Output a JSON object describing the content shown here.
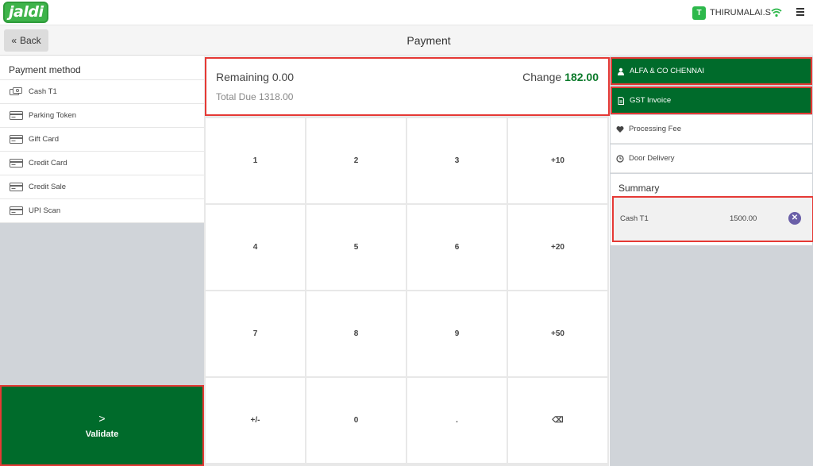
{
  "app": {
    "logo_text": "jaldi"
  },
  "topbar": {
    "user_initial": "T",
    "user_name": "THIRUMALAI.S"
  },
  "header": {
    "back_label": "Back",
    "title": "Payment"
  },
  "payment_methods": {
    "heading": "Payment method",
    "items": [
      {
        "label": "Cash T1",
        "icon": "cash-icon"
      },
      {
        "label": "Parking Token",
        "icon": "card-icon"
      },
      {
        "label": "Gift Card",
        "icon": "card-icon"
      },
      {
        "label": "Credit Card",
        "icon": "card-icon"
      },
      {
        "label": "Credit Sale",
        "icon": "card-icon"
      },
      {
        "label": "UPI Scan",
        "icon": "card-icon"
      }
    ]
  },
  "validate": {
    "arrow": ">",
    "label": "Validate"
  },
  "due": {
    "remaining_label": "Remaining",
    "remaining_value": "0.00",
    "change_label": "Change",
    "change_value": "182.00",
    "total_due_label": "Total Due",
    "total_due_value": "1318.00"
  },
  "keypad": [
    "1",
    "2",
    "3",
    "+10",
    "4",
    "5",
    "6",
    "+20",
    "7",
    "8",
    "9",
    "+50",
    "+/-",
    "0",
    ".",
    "⌫"
  ],
  "right_panel": {
    "customer_label": "ALFA & CO CHENNAI",
    "invoice_label": "GST Invoice",
    "processing_fee_label": "Processing Fee",
    "door_delivery_label": "Door Delivery",
    "summary_title": "Summary",
    "summary_lines": [
      {
        "name": "Cash T1",
        "amount": "1500.00"
      }
    ]
  },
  "colors": {
    "accent_green": "#006b2b",
    "highlight_red": "#e53935",
    "change_green": "#0b7a2a",
    "remove_purple": "#6a5fa8"
  }
}
